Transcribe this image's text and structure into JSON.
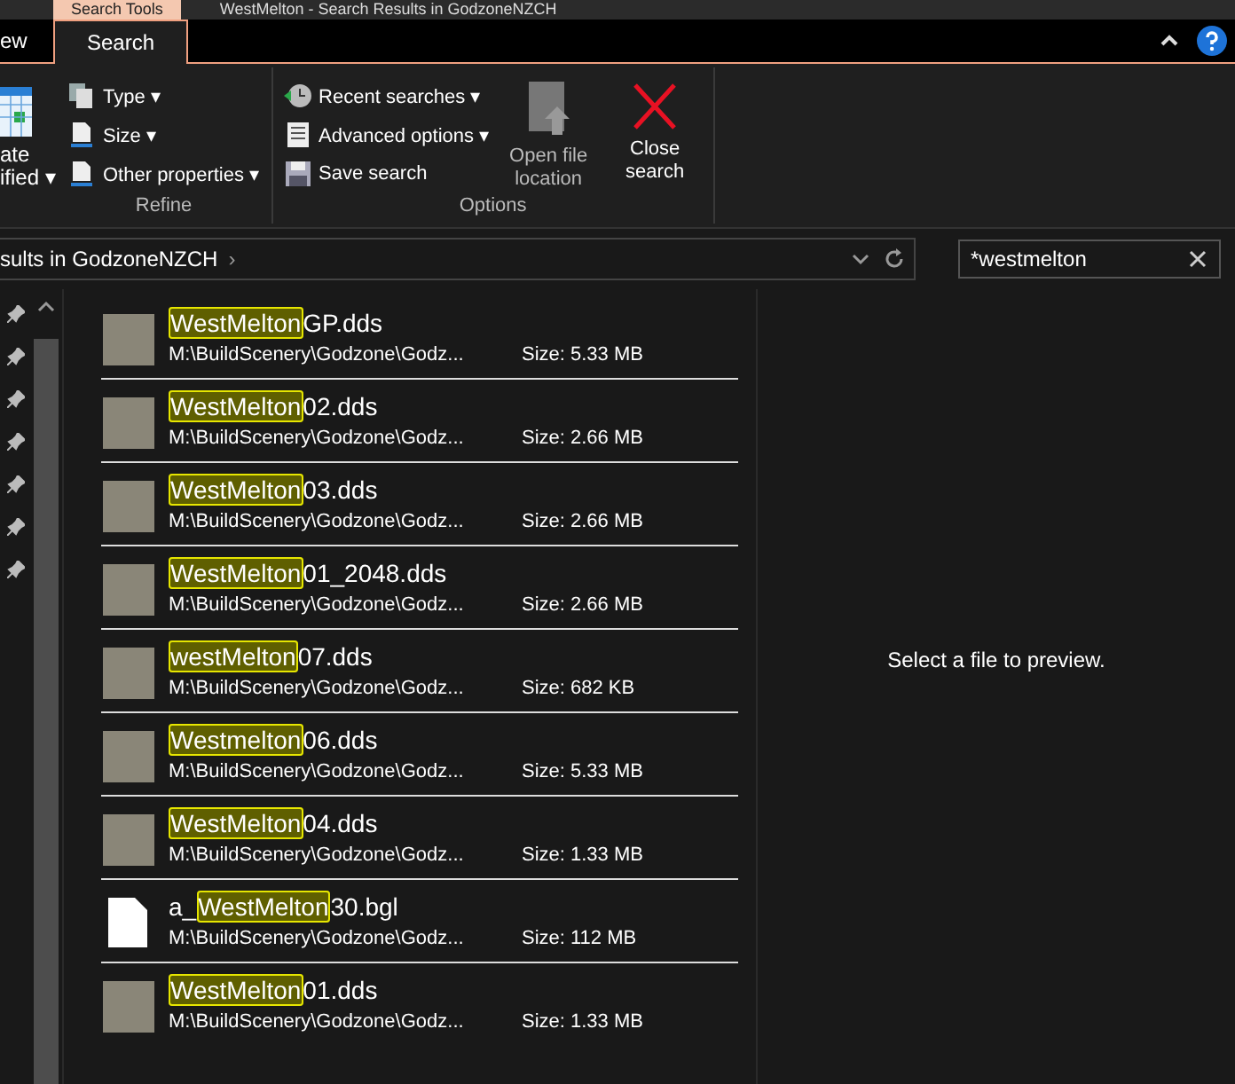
{
  "title_bar": {
    "context_tab": "Search Tools",
    "title": "WestMelton - Search Results in GodzoneNZCH"
  },
  "ribbon_tabs": [
    {
      "label": "ew",
      "selected": false
    },
    {
      "label": "Search",
      "selected": true
    }
  ],
  "ribbon": {
    "partial_group": {
      "lines": [
        "ate",
        "ified ▾"
      ]
    },
    "groups": [
      {
        "label": "Refine",
        "items": [
          {
            "label": "Type ▾"
          },
          {
            "label": "Size ▾"
          },
          {
            "label": "Other properties ▾"
          }
        ]
      },
      {
        "label": "Options",
        "items": [
          {
            "label": "Recent searches ▾"
          },
          {
            "label": "Advanced options ▾"
          },
          {
            "label": "Save search"
          }
        ],
        "big": [
          {
            "label": "Open file location",
            "disabled": true
          },
          {
            "label": "Close search",
            "disabled": false
          }
        ]
      }
    ]
  },
  "address": {
    "path": "sults in GodzoneNZCH",
    "chevron": "›"
  },
  "search": {
    "value": "*westmelton"
  },
  "results": [
    {
      "kind": "image",
      "match": "WestMelton",
      "after": "GP.dds",
      "path": "M:\\BuildScenery\\Godzone\\Godz...",
      "size_label": "Size:",
      "size": "5.33 MB"
    },
    {
      "kind": "image",
      "match": "WestMelton",
      "after": "02.dds",
      "path": "M:\\BuildScenery\\Godzone\\Godz...",
      "size_label": "Size:",
      "size": "2.66 MB"
    },
    {
      "kind": "image",
      "match": "WestMelton",
      "after": "03.dds",
      "path": "M:\\BuildScenery\\Godzone\\Godz...",
      "size_label": "Size:",
      "size": "2.66 MB"
    },
    {
      "kind": "image",
      "match": "WestMelton",
      "after": "01_2048.dds",
      "path": "M:\\BuildScenery\\Godzone\\Godz...",
      "size_label": "Size:",
      "size": "2.66 MB"
    },
    {
      "kind": "image",
      "match": "westMelton",
      "after": "07.dds",
      "path": "M:\\BuildScenery\\Godzone\\Godz...",
      "size_label": "Size:",
      "size": "682 KB"
    },
    {
      "kind": "image",
      "match": "Westmelton",
      "after": "06.dds",
      "path": "M:\\BuildScenery\\Godzone\\Godz...",
      "size_label": "Size:",
      "size": "5.33 MB"
    },
    {
      "kind": "image",
      "match": "WestMelton",
      "after": "04.dds",
      "path": "M:\\BuildScenery\\Godzone\\Godz...",
      "size_label": "Size:",
      "size": "1.33 MB"
    },
    {
      "kind": "file",
      "before": "a_",
      "match": "WestMelton",
      "after": "30.bgl",
      "path": "M:\\BuildScenery\\Godzone\\Godz...",
      "size_label": "Size:",
      "size": "112 MB"
    },
    {
      "kind": "image",
      "match": "WestMelton",
      "after": "01.dds",
      "path": "M:\\BuildScenery\\Godzone\\Godz...",
      "size_label": "Size:",
      "size": "1.33 MB"
    }
  ],
  "preview": {
    "message": "Select a file to preview."
  }
}
